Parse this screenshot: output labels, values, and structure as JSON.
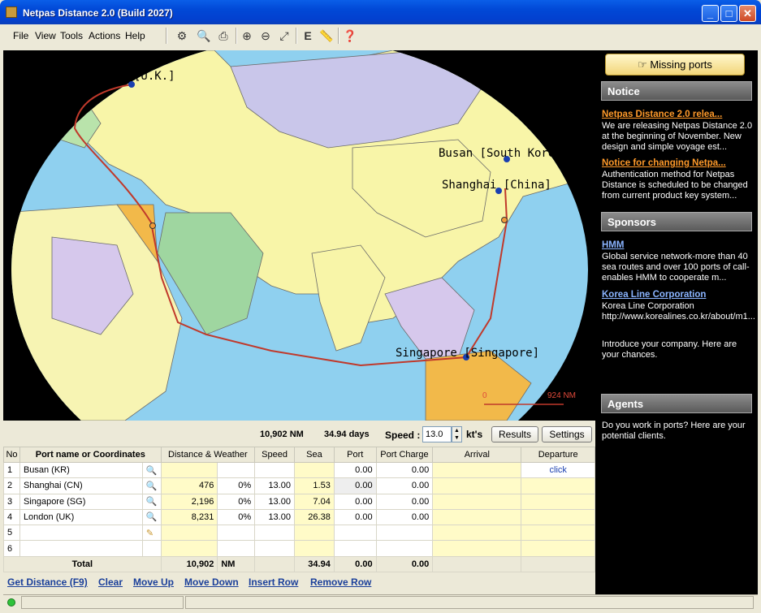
{
  "window": {
    "title": "Netpas Distance 2.0 (Build 2027)",
    "min": "_",
    "max": "□",
    "close": "✕"
  },
  "menu": [
    "File",
    "View",
    "Tools",
    "Actions",
    "Help"
  ],
  "toolbar_icons": [
    "options-icon",
    "print-preview-icon",
    "print-icon",
    "zoom-in-icon",
    "zoom-out-icon",
    "fit-icon",
    "e-icon",
    "ruler-icon",
    "help-icon"
  ],
  "map": {
    "labels": {
      "london": "London [U.K.]",
      "busan": "Busan [South Korea]",
      "shanghai": "Shanghai [China]",
      "singapore": "Singapore [Singapore]"
    },
    "scale_start": "0",
    "scale_end": "924 NM"
  },
  "sidebar": {
    "missing_ports": "Missing ports",
    "notice_title": "Notice",
    "notice1_link": "Netpas Distance 2.0 relea...",
    "notice1_text": "We are releasing Netpas Distance 2.0 at the beginning of November. New design and simple voyage est...",
    "notice2_link": "Notice for changing Netpa...",
    "notice2_text": "Authentication method for Netpas Distance is scheduled to be changed from current product key system...",
    "sponsors_title": "Sponsors",
    "sp1_link": "HMM",
    "sp1_text": "Global service network-more than 40 sea routes and over 100 ports of call-enables HMM to cooperate m...",
    "sp2_link": "Korea Line Corporation",
    "sp2_text": "Korea Line Corporation http://www.korealines.co.kr/about/m1...",
    "intro_text": "Introduce your company. Here are your chances.",
    "agents_title": "Agents",
    "agents_text": "Do you work in ports? Here are your potential clients."
  },
  "summary": {
    "distance": "10,902 NM",
    "days": "34.94 days",
    "speed_label": "Speed :",
    "speed_value": "13.0",
    "speed_unit": "kt's",
    "results": "Results",
    "settings": "Settings"
  },
  "columns": [
    "No",
    "Port name or Coordinates",
    "Distance & Weather",
    "Speed",
    "Sea",
    "Port",
    "Port Charge",
    "Arrival",
    "Departure"
  ],
  "rows": [
    {
      "no": "1",
      "port": "Busan (KR)",
      "dist": "",
      "weather": "",
      "speed": "",
      "sea": "",
      "port_days": "0.00",
      "charge": "0.00",
      "arrival": "",
      "departure": "click"
    },
    {
      "no": "2",
      "port": "Shanghai (CN)",
      "dist": "476",
      "weather": "0%",
      "speed": "13.00",
      "sea": "1.53",
      "port_days": "0.00",
      "charge": "0.00",
      "arrival": "",
      "departure": ""
    },
    {
      "no": "3",
      "port": "Singapore (SG)",
      "dist": "2,196",
      "weather": "0%",
      "speed": "13.00",
      "sea": "7.04",
      "port_days": "0.00",
      "charge": "0.00",
      "arrival": "",
      "departure": ""
    },
    {
      "no": "4",
      "port": "London (UK)",
      "dist": "8,231",
      "weather": "0%",
      "speed": "13.00",
      "sea": "26.38",
      "port_days": "0.00",
      "charge": "0.00",
      "arrival": "",
      "departure": ""
    },
    {
      "no": "5",
      "port": "",
      "dist": "",
      "weather": "",
      "speed": "",
      "sea": "",
      "port_days": "",
      "charge": "",
      "arrival": "",
      "departure": ""
    },
    {
      "no": "6",
      "port": "",
      "dist": "",
      "weather": "",
      "speed": "",
      "sea": "",
      "port_days": "",
      "charge": "",
      "arrival": "",
      "departure": ""
    }
  ],
  "total": {
    "label": "Total",
    "dist": "10,902",
    "unit": "NM",
    "sea": "34.94",
    "port": "0.00",
    "charge": "0.00"
  },
  "actions": [
    "Get Distance (F9)",
    "Clear",
    "Move Up",
    "Move Down",
    "Insert Row",
    "Remove Row"
  ]
}
